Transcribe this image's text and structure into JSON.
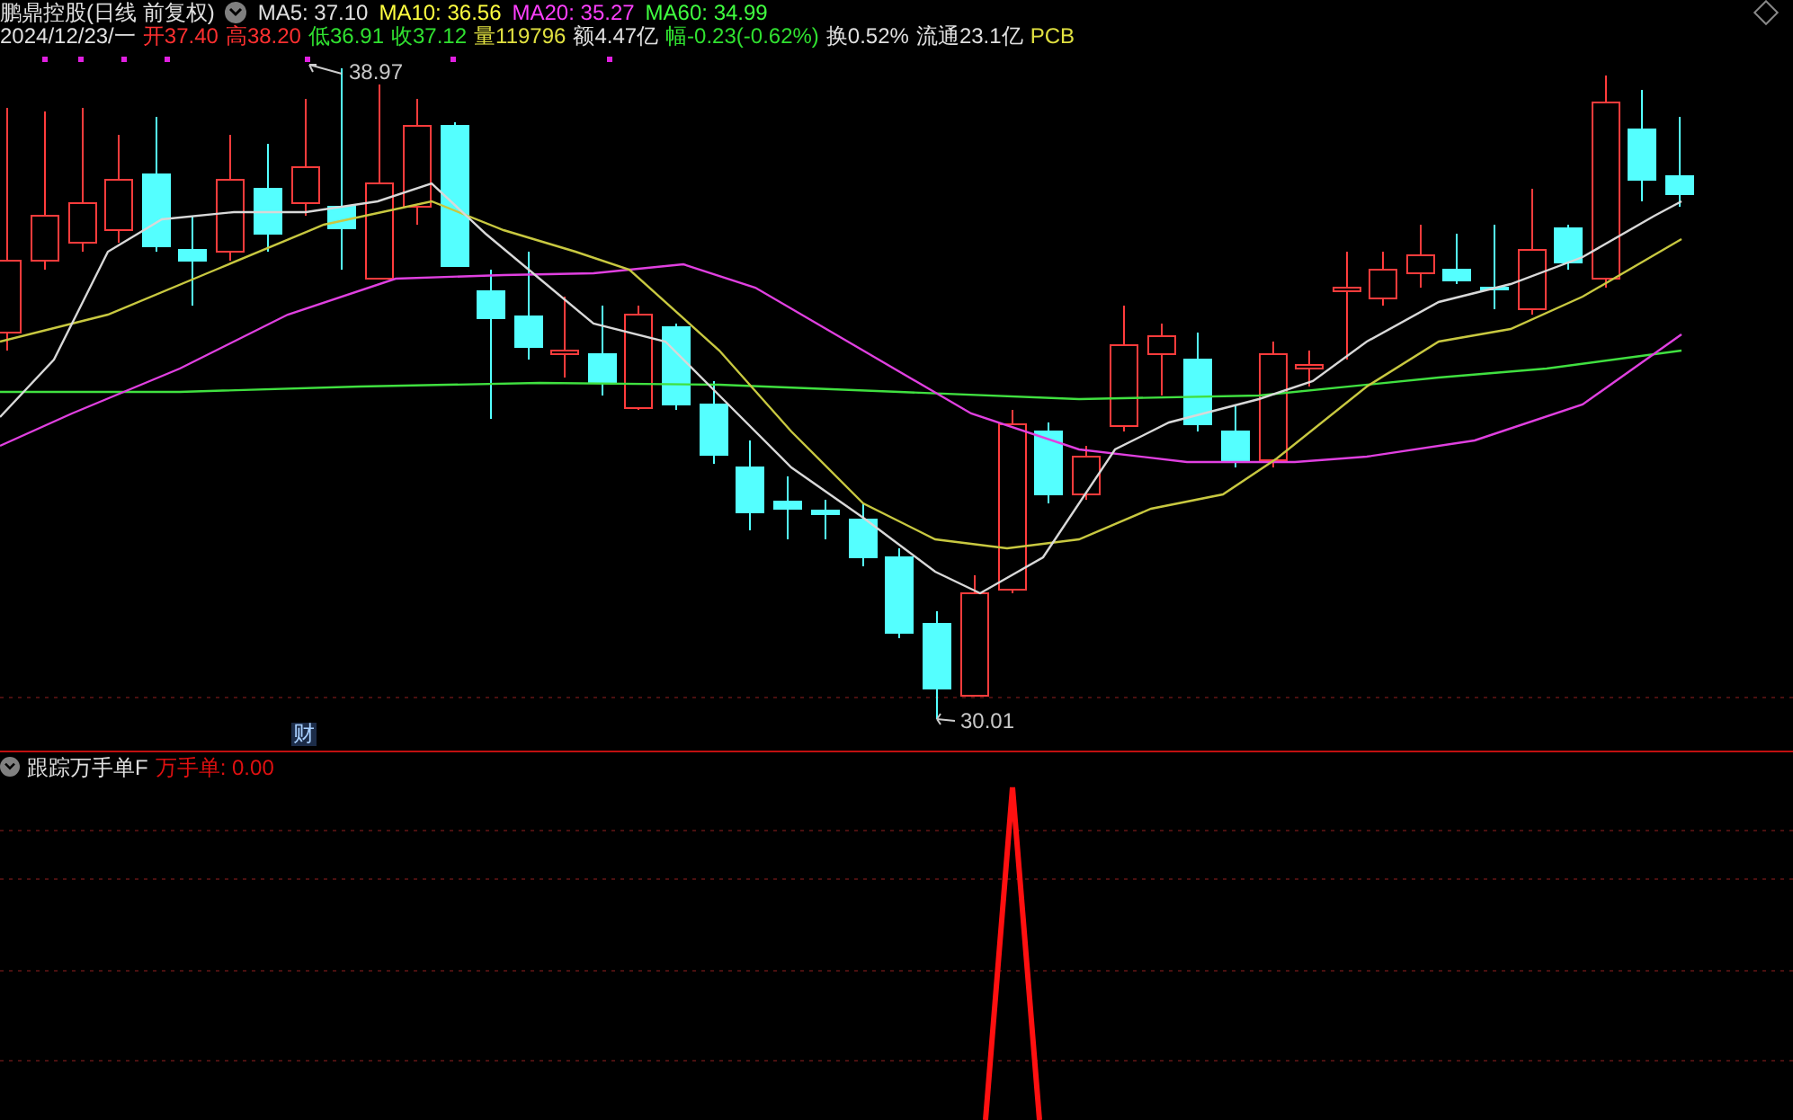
{
  "header": {
    "stock_name": "鹏鼎控股(日线 前复权)",
    "moving_averages": [
      {
        "label": "MA5: 37.10",
        "color": "#e0e0e0"
      },
      {
        "label": "MA10: 36.56",
        "color": "#ffff40"
      },
      {
        "label": "MA20: 35.27",
        "color": "#ff40ff"
      },
      {
        "label": "MA60: 34.99",
        "color": "#40ff40"
      }
    ]
  },
  "quote": {
    "date": "2024/12/23/一",
    "items": [
      {
        "label": "开",
        "value": "37.40",
        "color": "#ff3030"
      },
      {
        "label": "高",
        "value": "38.20",
        "color": "#ff3030"
      },
      {
        "label": "低",
        "value": "36.91",
        "color": "#30e030"
      },
      {
        "label": "收",
        "value": "37.12",
        "color": "#30e030"
      },
      {
        "label": "量",
        "value": "119796",
        "color": "#e0e040"
      },
      {
        "label": "额",
        "value": "4.47亿",
        "color": "#e0e0e0"
      },
      {
        "label": "幅",
        "value": "-0.23(-0.62%)",
        "color": "#30e030"
      },
      {
        "label": "换",
        "value": "0.52%",
        "color": "#e0e0e0"
      },
      {
        "label": "流通",
        "value": "23.1亿",
        "color": "#e0e0e0"
      },
      {
        "label": "PCB",
        "value": "",
        "color": "#e0e040"
      }
    ]
  },
  "price_chart": {
    "high_label": "38.97",
    "low_label": "30.01",
    "event_badge": "财"
  },
  "indicator": {
    "name": "跟踪万手单F",
    "reading": "万手单: 0.00"
  }
}
